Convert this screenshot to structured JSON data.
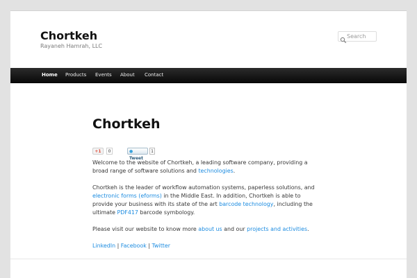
{
  "header": {
    "site_title": "Chortkeh",
    "site_description": "Rayaneh Hamrah, LLC",
    "search_placeholder": "Search",
    "search_icon": "search-icon"
  },
  "nav": {
    "items": [
      {
        "label": "Home",
        "active": true
      },
      {
        "label": "Products",
        "active": false
      },
      {
        "label": "Events",
        "active": false
      },
      {
        "label": "About",
        "active": false
      },
      {
        "label": "Contact",
        "active": false
      }
    ]
  },
  "entry": {
    "title": "Chortkeh"
  },
  "share": {
    "gplus_label": "+1",
    "gplus_count": "0",
    "tweet_label": "Tweet",
    "tweet_count": "1"
  },
  "content": {
    "p1_text": "Welcome to the website of Chortkeh, a leading software company, providing a broad range of software solutions and ",
    "p1_link": "technologies",
    "p1_end": ".",
    "p2_text1": "Chortkeh is the leader of workflow automation systems, paperless solutions, and ",
    "p2_link1": "electronic forms (eforms)",
    "p2_text2": " in the Middle East. In addition, Chortkeh is able to provide your business with its state of the art ",
    "p2_link2": "barcode technology",
    "p2_text3": ", including the ultimate ",
    "p2_link3": "PDF417",
    "p2_text4": " barcode symbology.",
    "p3_text1": "Please visit our website to know more ",
    "p3_link1": "about us",
    "p3_text2": " and our ",
    "p3_link2": "projects and activities",
    "p3_end": ".",
    "social_links": [
      "LinkedIn",
      "Facebook",
      "Twitter"
    ],
    "social_separator": " | "
  },
  "colors": {
    "link": "#1b8be0",
    "nav_bg": "#111111",
    "page_bg": "#e2e2e2"
  }
}
